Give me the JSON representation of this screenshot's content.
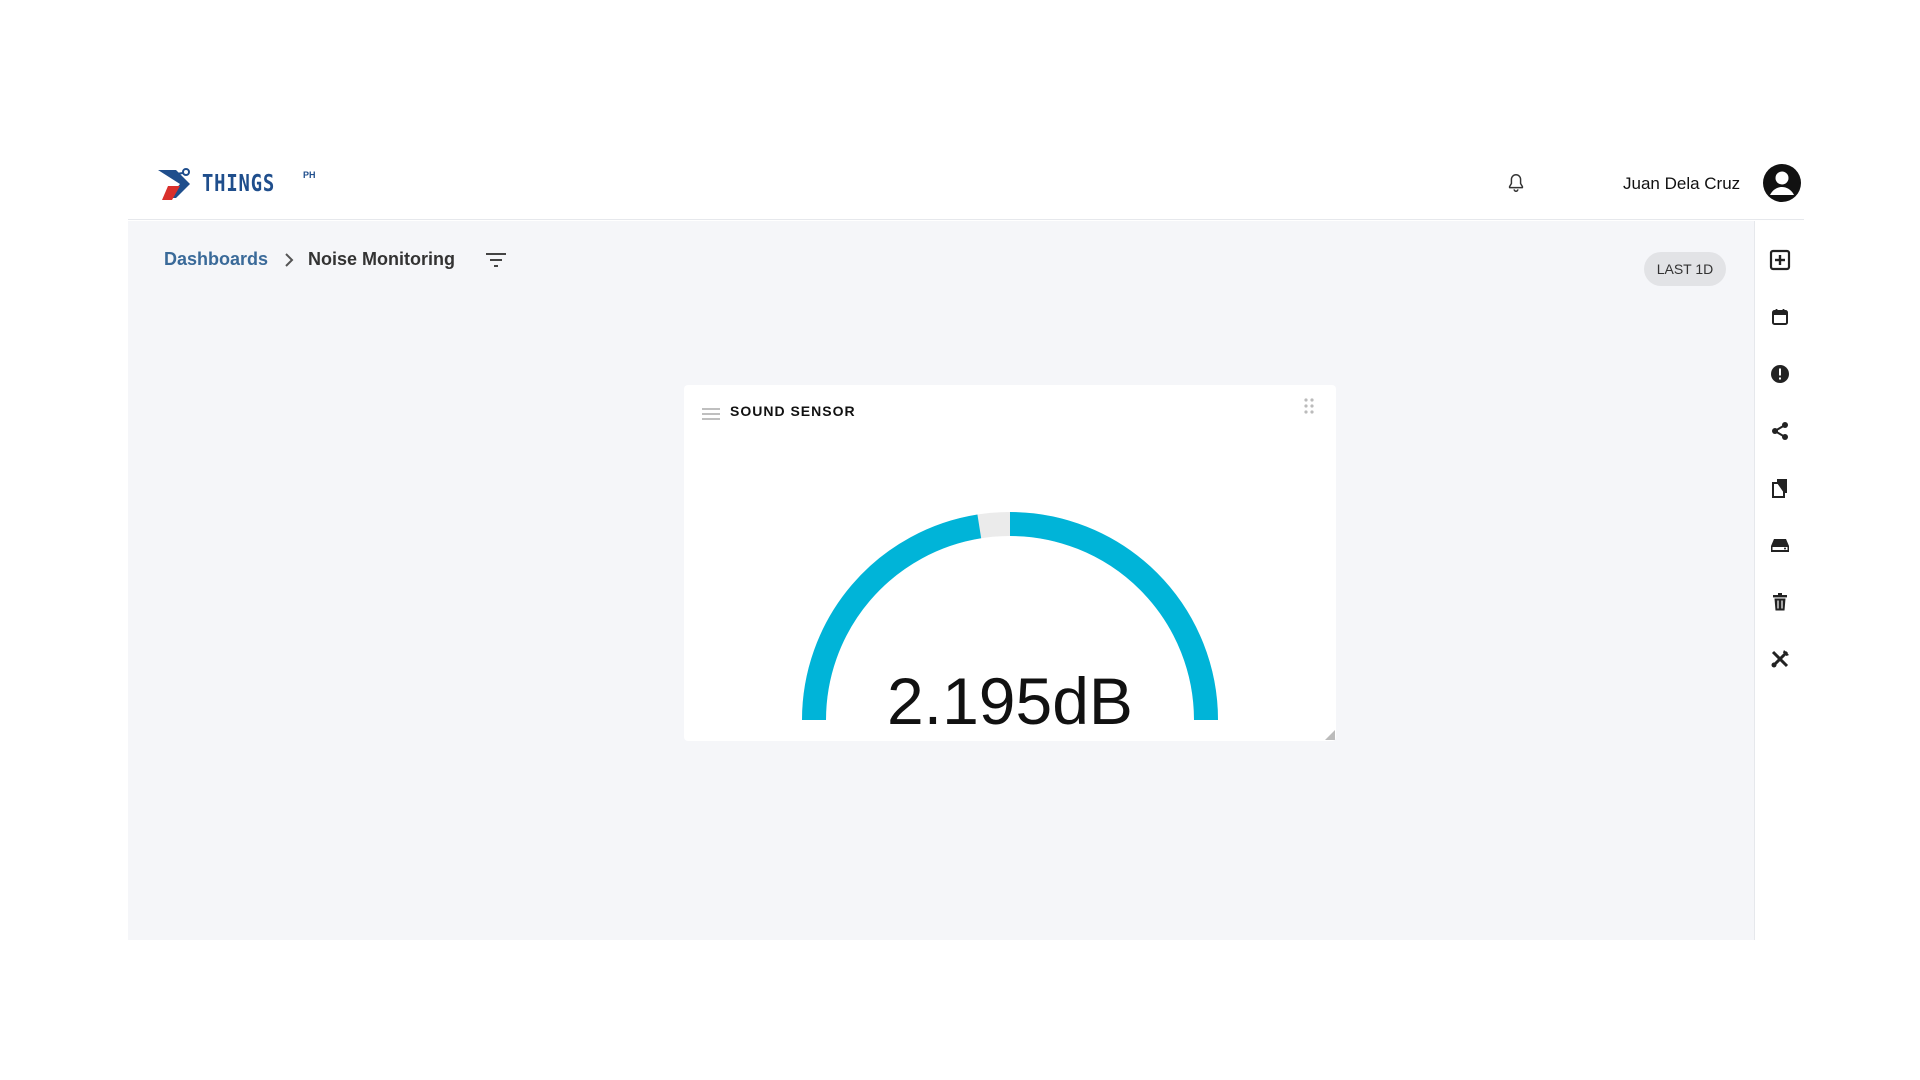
{
  "header": {
    "logo_text": "THINGS",
    "logo_sup": "PH",
    "user_name": "Juan Dela Cruz",
    "icons": [
      "bell-icon",
      "account-circle-icon"
    ]
  },
  "breadcrumb": {
    "root": "Dashboards",
    "current": "Noise Monitoring"
  },
  "time_range": "LAST 1D",
  "widget": {
    "title": "SOUND SENSOR",
    "value_display": "2.195dB",
    "gauge_fill_fraction": 0.45,
    "gauge_color": "#00b4d8",
    "gauge_track_color": "#ebebeb"
  },
  "sidebar_actions": [
    {
      "name": "add-widget",
      "icon": "add-box-icon"
    },
    {
      "name": "calendar",
      "icon": "calendar-icon"
    },
    {
      "name": "alerts",
      "icon": "alert-circle-icon"
    },
    {
      "name": "share",
      "icon": "share-icon"
    },
    {
      "name": "copy",
      "icon": "copy-icon"
    },
    {
      "name": "storage",
      "icon": "storage-icon"
    },
    {
      "name": "delete",
      "icon": "trash-icon"
    },
    {
      "name": "tools",
      "icon": "tools-icon"
    }
  ],
  "colors": {
    "brand_blue": "#1f4e8c",
    "brand_red": "#d9302c",
    "link": "#3a6a99",
    "canvas_bg": "#f5f6f9"
  }
}
